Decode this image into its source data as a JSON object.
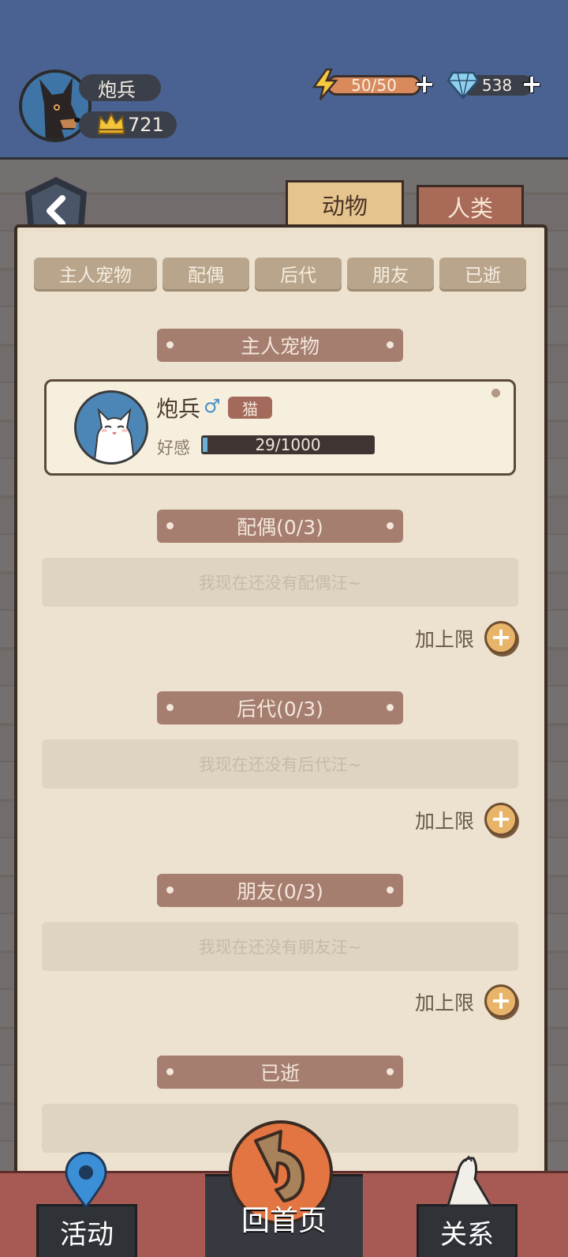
{
  "player": {
    "name": "炮兵",
    "score": "721",
    "energy": "50/50",
    "energy_fraction": 1.0,
    "gems": "538"
  },
  "tabs": [
    {
      "label": "动物",
      "active": true
    },
    {
      "label": "人类",
      "active": false
    }
  ],
  "filters": [
    "主人宠物",
    "配偶",
    "后代",
    "朋友",
    "已逝"
  ],
  "sections": {
    "master": {
      "title": "主人宠物",
      "pet": {
        "name": "炮兵",
        "gender_symbol": "♂",
        "species": "猫",
        "affinity_label": "好感",
        "affinity_text": "29/1000",
        "affinity_fraction": 0.029
      }
    },
    "spouse": {
      "title": "配偶(0/3)",
      "empty_text": "我现在还没有配偶汪~",
      "add_label": "加上限"
    },
    "offspring": {
      "title": "后代(0/3)",
      "empty_text": "我现在还没有后代汪~",
      "add_label": "加上限"
    },
    "friends": {
      "title": "朋友(0/3)",
      "empty_text": "我现在还没有朋友汪~",
      "add_label": "加上限"
    },
    "deceased": {
      "title": "已逝",
      "empty_text": ""
    }
  },
  "nav": {
    "activity": "活动",
    "home": "回首页",
    "relations": "关系"
  },
  "colors": {
    "topbar": "#4a6291",
    "parchment": "#ece2cf",
    "banner": "#a57e70",
    "active_tab": "#e5c48e",
    "inactive_tab": "#a96a58",
    "nav_bar": "#a75a54"
  }
}
